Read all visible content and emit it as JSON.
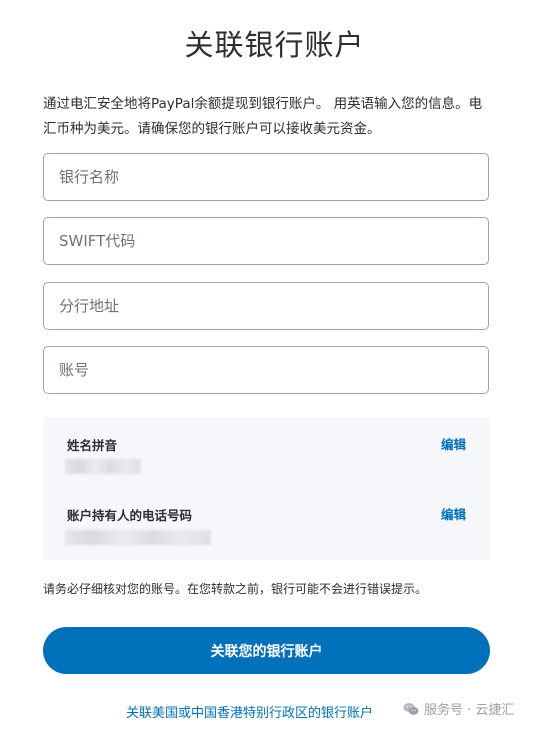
{
  "page": {
    "title": "关联银行账户",
    "intro": "通过电汇安全地将PayPal余额提现到银行账户。 用英语输入您的信息。电汇币种为美元。请确保您的银行账户可以接收美元资金。"
  },
  "form": {
    "bank_name_placeholder": "银行名称",
    "swift_placeholder": "SWIFT代码",
    "branch_address_placeholder": "分行地址",
    "account_number_placeholder": "账号"
  },
  "info": {
    "name_label": "姓名拼音",
    "name_edit": "编辑",
    "phone_label": "账户持有人的电话号码",
    "phone_edit": "编辑"
  },
  "note": "请务必仔细核对您的账号。在您转款之前，银行可能不会进行错误提示。",
  "primary_button": "关联您的银行账户",
  "footer_link": "关联美国或中国香港特别行政区的银行账户",
  "watermark": {
    "icon": "wechat-icon",
    "text": "服务号 · 云捷汇"
  },
  "colors": {
    "accent": "#0070ba",
    "panel": "#f5f7fa"
  }
}
